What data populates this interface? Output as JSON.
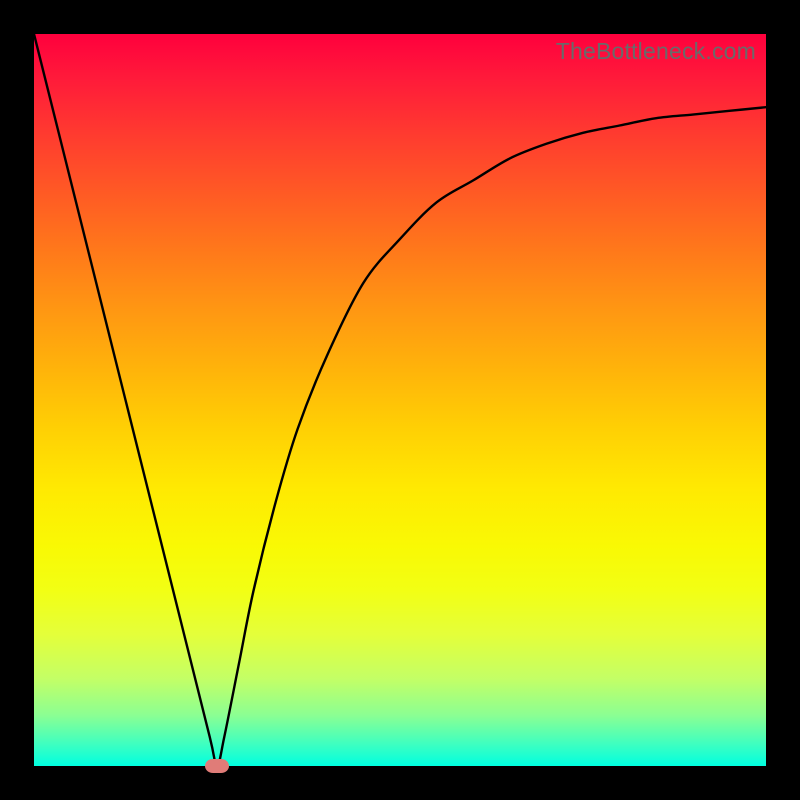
{
  "watermark": "TheBottleneck.com",
  "chart_data": {
    "type": "line",
    "title": "",
    "xlabel": "",
    "ylabel": "",
    "xlim": [
      0,
      100
    ],
    "ylim": [
      0,
      100
    ],
    "grid": false,
    "series": [
      {
        "name": "curve",
        "x": [
          0,
          5,
          10,
          15,
          20,
          24,
          25,
          26,
          28,
          30,
          33,
          36,
          40,
          45,
          50,
          55,
          60,
          65,
          70,
          75,
          80,
          85,
          90,
          95,
          100
        ],
        "y": [
          100,
          80,
          60,
          40,
          20,
          4,
          0,
          4,
          14,
          24,
          36,
          46,
          56,
          66,
          72,
          77,
          80,
          83,
          85,
          86.5,
          87.5,
          88.5,
          89,
          89.5,
          90
        ]
      }
    ],
    "marker": {
      "x": 25,
      "y": 0,
      "color": "#e07c78"
    },
    "background_gradient": {
      "stops": [
        {
          "pos": 0,
          "color": "#ff003d"
        },
        {
          "pos": 50,
          "color": "#ffd000"
        },
        {
          "pos": 80,
          "color": "#e8ff30"
        },
        {
          "pos": 100,
          "color": "#00ffe0"
        }
      ]
    }
  }
}
